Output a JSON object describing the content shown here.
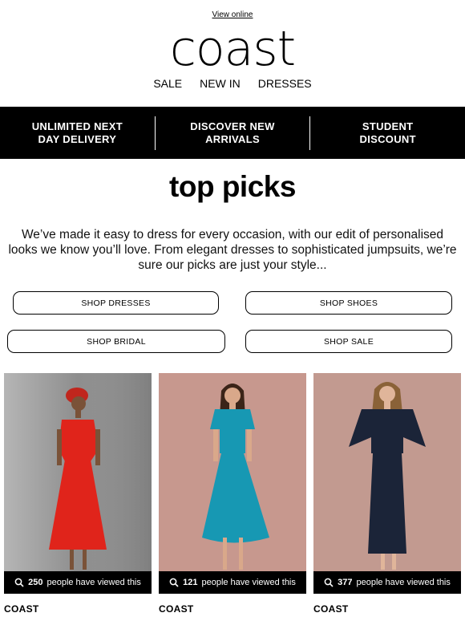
{
  "header": {
    "view_online": "View online",
    "logo": "coast",
    "nav": [
      "SALE",
      "NEW IN",
      "DRESSES"
    ]
  },
  "promos": [
    {
      "line1": "UNLIMITED NEXT",
      "line2": "DAY DELIVERY"
    },
    {
      "line1": "DISCOVER NEW",
      "line2": "ARRIVALS"
    },
    {
      "line1": "STUDENT",
      "line2": "DISCOUNT"
    }
  ],
  "title": "top picks",
  "intro": "We’ve made it easy to dress for every occasion, with our edit of personalised looks we know you’ll love. From elegant dresses to sophisticated jumpsuits, we’re sure our picks are just your style...",
  "buttons": [
    "SHOP DRESSES",
    "SHOP SHOES",
    "SHOP BRIDAL",
    "SHOP SALE"
  ],
  "products": [
    {
      "brand": "COAST",
      "views": "250",
      "views_text": "people have viewed this",
      "dress_color": "#e0241b",
      "bg_color": "#8e8e8e"
    },
    {
      "brand": "COAST",
      "views": "121",
      "views_text": "people have viewed this",
      "dress_color": "#1798b3",
      "bg_color": "#c7988e"
    },
    {
      "brand": "COAST",
      "views": "377",
      "views_text": "people have viewed this",
      "dress_color": "#1b2438",
      "bg_color": "#c29a90"
    }
  ],
  "icons": {
    "views": "search-icon"
  }
}
